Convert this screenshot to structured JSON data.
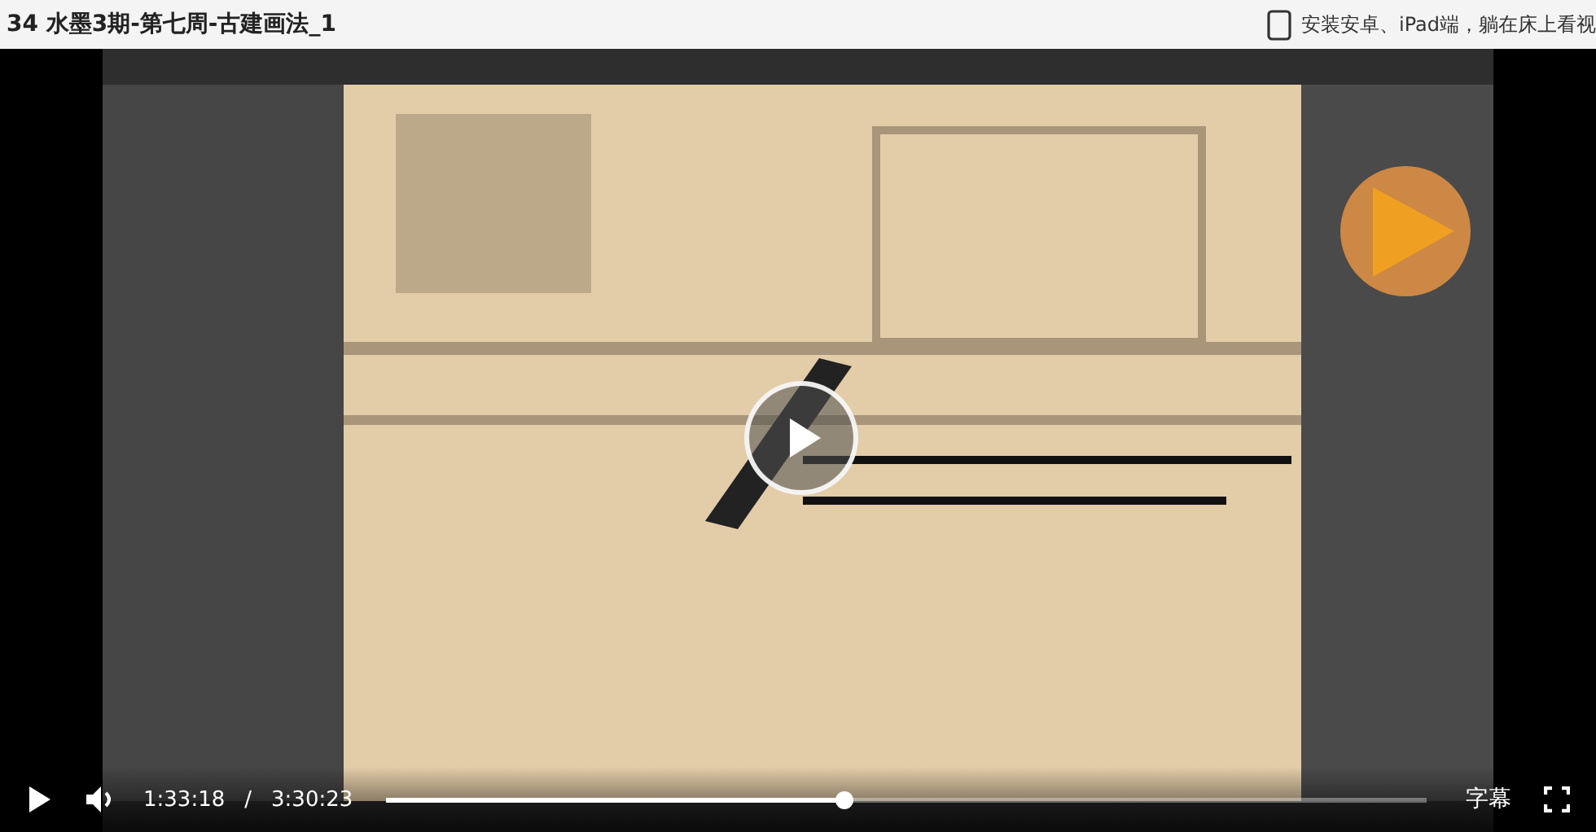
{
  "title": "34 水墨3期-第七周-古建画法_1",
  "app_promo": "安装安卓、iPad端，躺在床上看视",
  "player": {
    "playing": false,
    "current_time": "1:33:18",
    "separator": "/",
    "duration": "3:30:23",
    "level": 0.44,
    "subtitle_button": "字幕"
  }
}
